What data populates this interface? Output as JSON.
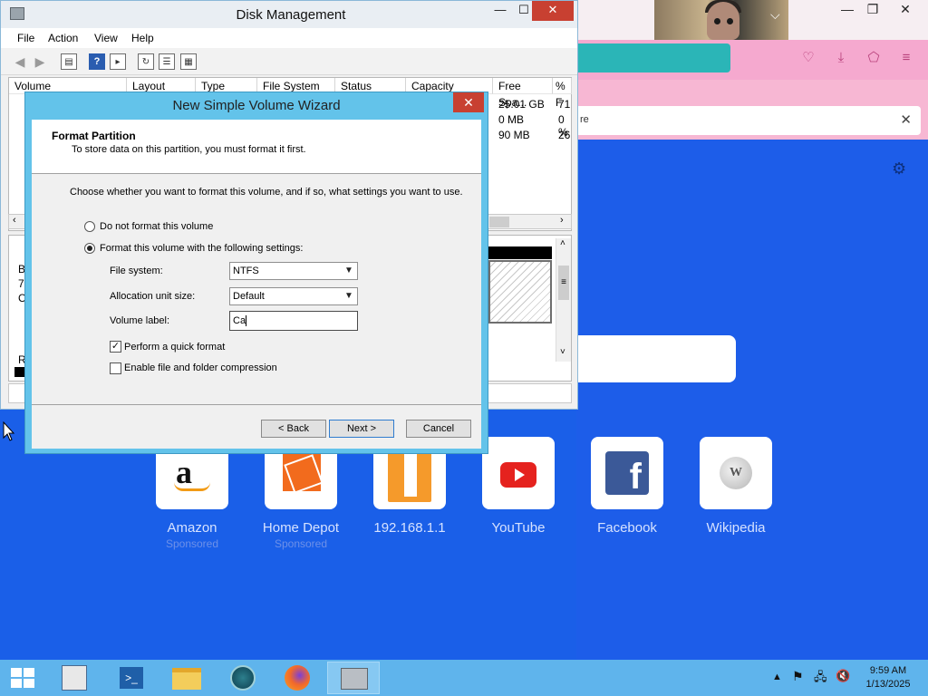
{
  "disk_mgmt": {
    "title": "Disk Management",
    "menu": [
      "File",
      "Action",
      "View",
      "Help"
    ],
    "columns": [
      "Volume",
      "Layout",
      "Type",
      "File System",
      "Status",
      "Capacity",
      "Free Spa...",
      "% F"
    ],
    "rows": [
      {
        "free": "25.01 GB",
        "pct": "71"
      },
      {
        "free": "0 MB",
        "pct": "0 %"
      },
      {
        "free": "90 MB",
        "pct": "26"
      }
    ],
    "lower_fragments": [
      "B",
      "7",
      "C",
      "R"
    ]
  },
  "wizard": {
    "title": "New Simple Volume Wizard",
    "heading": "Format Partition",
    "subheading": "To store data on this partition, you must format it first.",
    "intro": "Choose whether you want to format this volume, and if so, what settings you want to use.",
    "opt_no_format": "Do not format this volume",
    "opt_format": "Format this volume with the following settings:",
    "fs_label": "File system:",
    "fs_value": "NTFS",
    "alloc_label": "Allocation unit size:",
    "alloc_value": "Default",
    "vol_label": "Volume label:",
    "vol_value": "Ca",
    "quick_format": "Perform a quick format",
    "compression": "Enable file and folder compression",
    "back": "< Back",
    "next": "Next >",
    "cancel": "Cancel"
  },
  "browser": {
    "notif_fragment": "re",
    "tiles": [
      {
        "name": "Amazon",
        "sub": "Sponsored",
        "icon": "amazon-logo-icon"
      },
      {
        "name": "Home Depot",
        "sub": "Sponsored",
        "icon": "home-depot-logo-icon"
      },
      {
        "name": "192.168.1.1",
        "sub": "",
        "icon": "numeral-one-icon"
      },
      {
        "name": "YouTube",
        "sub": "",
        "icon": "youtube-logo-icon"
      },
      {
        "name": "Facebook",
        "sub": "",
        "icon": "facebook-logo-icon"
      },
      {
        "name": "Wikipedia",
        "sub": "",
        "icon": "wikipedia-globe-icon"
      }
    ]
  },
  "taskbar": {
    "time": "9:59 AM",
    "date": "1/13/2025"
  },
  "colors": {
    "desktop": "#1a5fe8",
    "taskbar": "#5fb4ec",
    "wizard_frame": "#63c3ea",
    "close_red": "#c84031",
    "browser_pink": "#f5a9cf"
  }
}
